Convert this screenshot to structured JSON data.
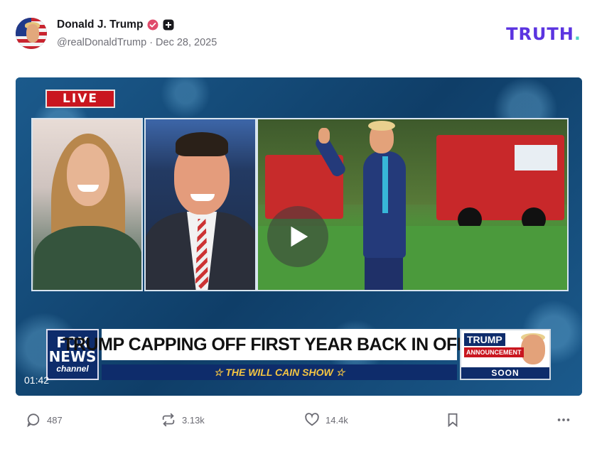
{
  "post": {
    "author_name": "Donald J. Trump",
    "handle": "@realDonaldTrump",
    "separator": "·",
    "date": "Dec 28, 2025"
  },
  "brand": {
    "text": "TRUTH",
    "dot": "."
  },
  "video": {
    "live_label": "LIVE",
    "headline": "TRUMP CAPPING OFF FIRST YEAR BACK IN OFFICE",
    "show_name": "☆ THE WILL CAIN SHOW ☆",
    "network_line1": "FOX",
    "network_line2": "NEWS",
    "network_line3": "channel",
    "promo_line1": "TRUMP",
    "promo_line2": "ANNOUNCEMENT",
    "promo_line3": "SOON",
    "timestamp": "01:42"
  },
  "actions": {
    "reply_count": "487",
    "retruth_count": "3.13k",
    "like_count": "14.4k"
  },
  "colors": {
    "brand": "#5b34e0",
    "verified": "#e04b6b",
    "live_red": "#c9161f",
    "fox_navy": "#0e2c6b"
  },
  "icons": [
    "verified-badge-icon",
    "plus-badge-icon",
    "play-icon",
    "comment-icon",
    "retruth-icon",
    "heart-icon",
    "bookmark-icon",
    "more-icon"
  ]
}
